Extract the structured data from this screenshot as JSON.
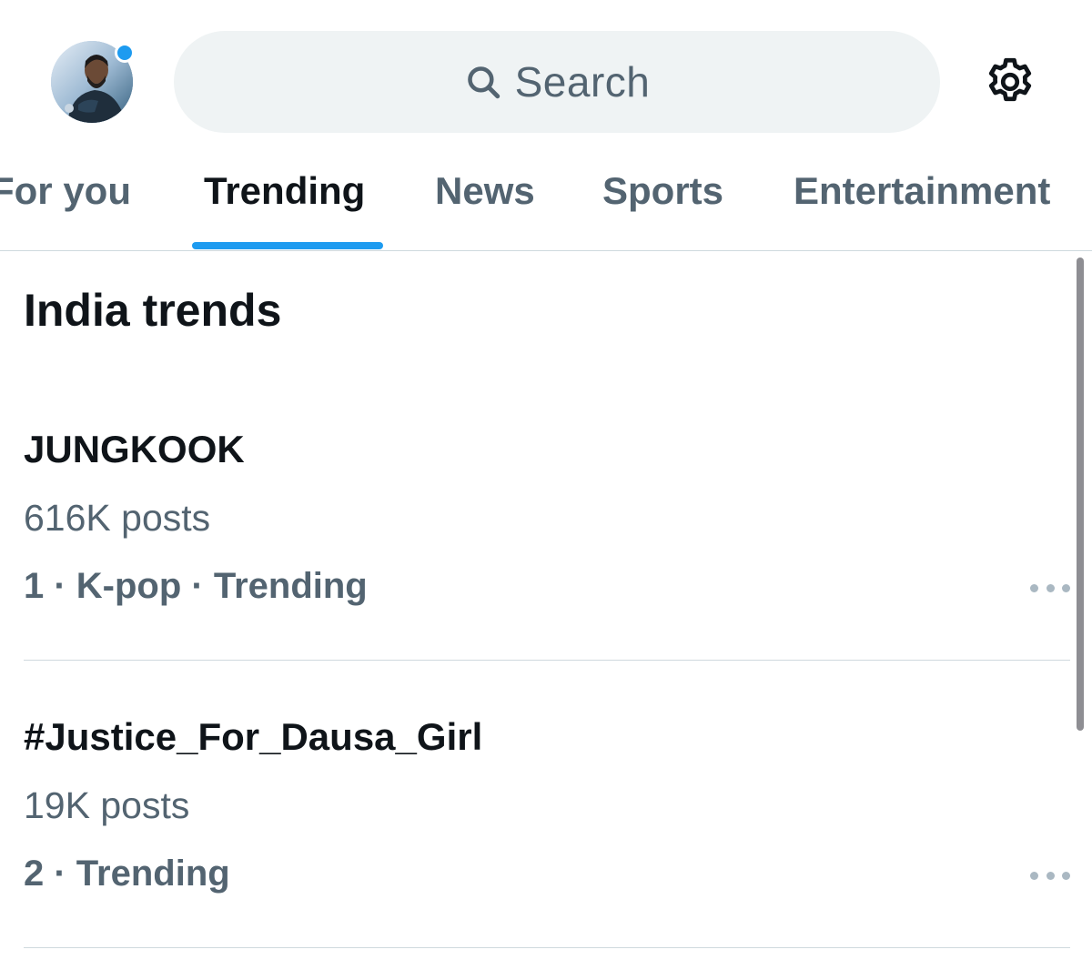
{
  "header": {
    "search_placeholder": "Search"
  },
  "tabs": [
    {
      "label": "For you",
      "active": false
    },
    {
      "label": "Trending",
      "active": true
    },
    {
      "label": "News",
      "active": false
    },
    {
      "label": "Sports",
      "active": false
    },
    {
      "label": "Entertainment",
      "active": false
    }
  ],
  "section": {
    "title": "India trends"
  },
  "trends": [
    {
      "name": "JUNGKOOK",
      "posts": "616K posts",
      "meta": "1 · K-pop · Trending"
    },
    {
      "name": "#Justice_For_Dausa_Girl",
      "posts": "19K posts",
      "meta": "2 · Trending"
    }
  ],
  "colors": {
    "accent": "#1d9bf0",
    "text_primary": "#0f1419",
    "text_secondary": "#536471",
    "search_bg": "#eff3f4",
    "divider": "#cfd9de"
  },
  "icons": {
    "avatar": "profile-photo",
    "search": "search-icon",
    "settings": "gear-icon",
    "more": "more-horizontal-icon"
  }
}
